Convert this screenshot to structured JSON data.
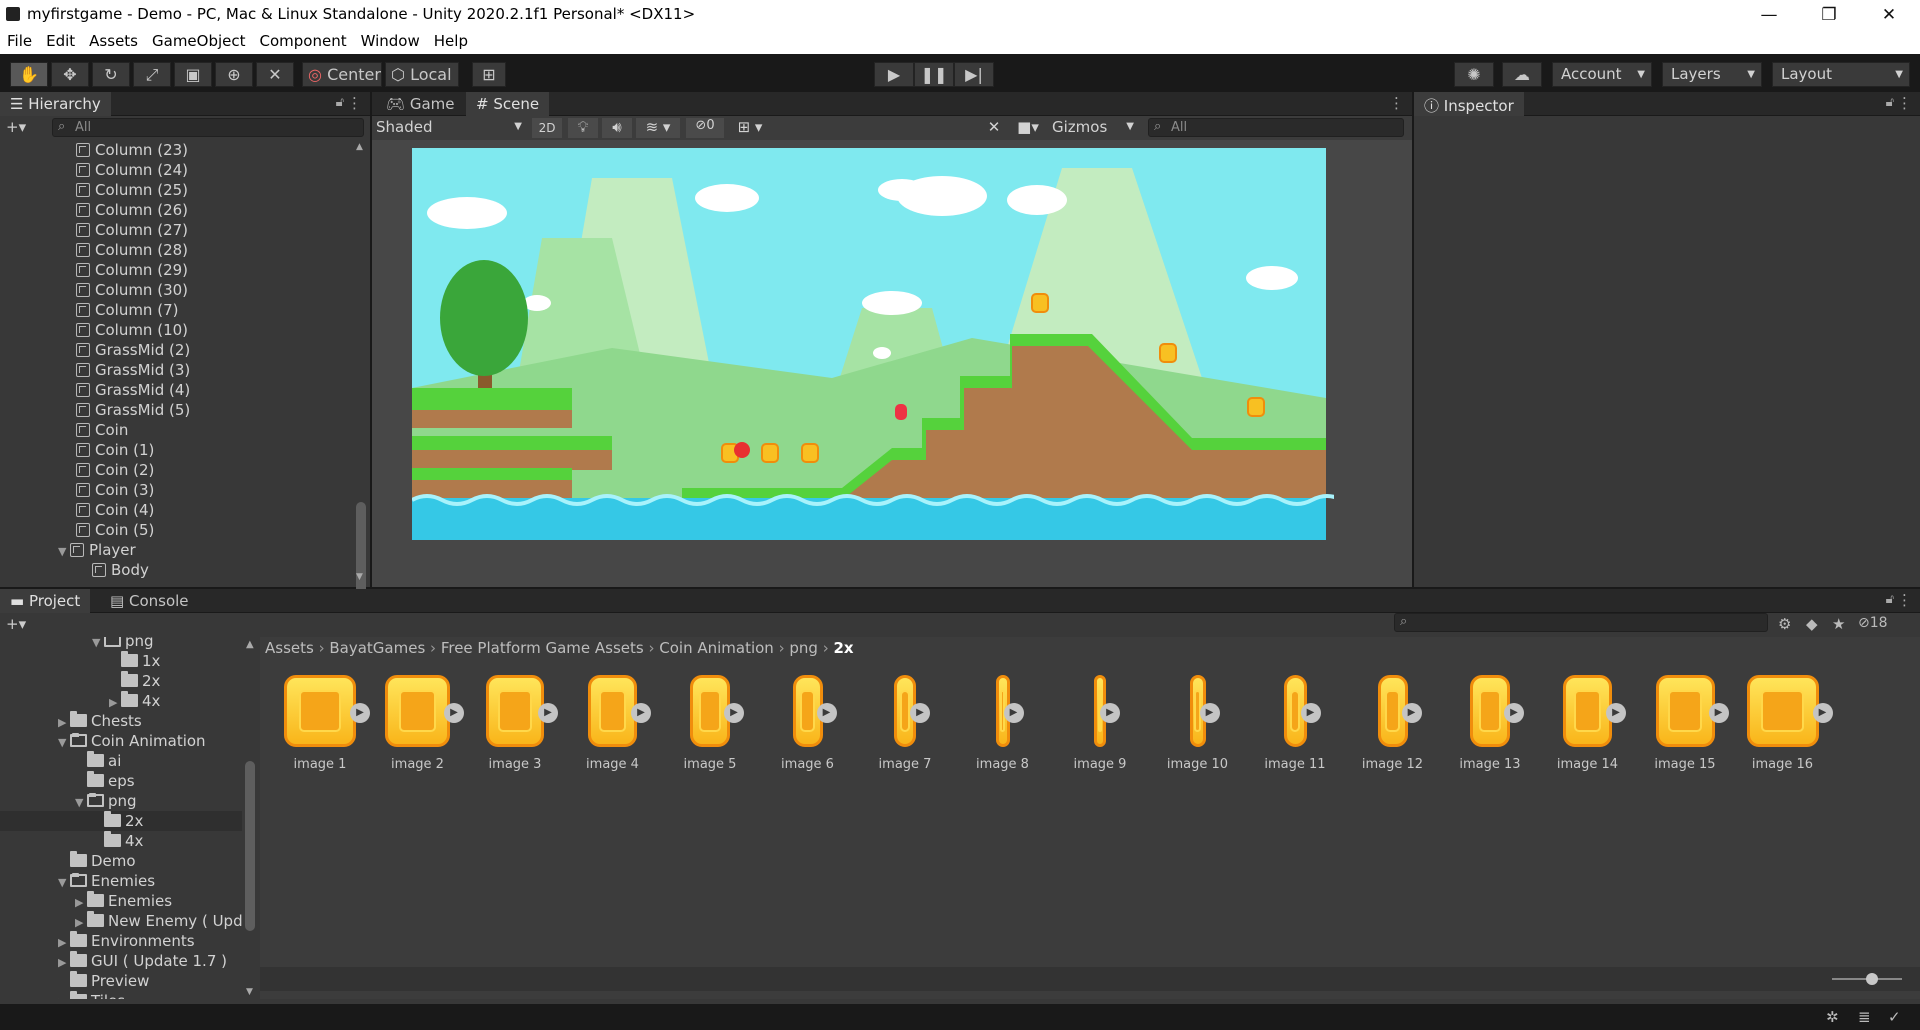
{
  "window": {
    "title": "myfirstgame - Demo - PC, Mac & Linux Standalone - Unity 2020.2.1f1 Personal* <DX11>",
    "minimize": "—",
    "maximize": "❐",
    "close": "✕"
  },
  "menu": [
    "File",
    "Edit",
    "Assets",
    "GameObject",
    "Component",
    "Window",
    "Help"
  ],
  "toolbar": {
    "pivot": "Center",
    "space": "Local",
    "account": "Account",
    "layers": "Layers",
    "layout": "Layout"
  },
  "hierarchy": {
    "tab": "Hierarchy",
    "add": "+▾",
    "search_placeholder": "All",
    "items": [
      {
        "label": "Column (23)",
        "type": "object",
        "depth": 1
      },
      {
        "label": "Column (24)",
        "type": "object",
        "depth": 1
      },
      {
        "label": "Column (25)",
        "type": "object",
        "depth": 1
      },
      {
        "label": "Column (26)",
        "type": "object",
        "depth": 1
      },
      {
        "label": "Column (27)",
        "type": "object",
        "depth": 1
      },
      {
        "label": "Column (28)",
        "type": "object",
        "depth": 1
      },
      {
        "label": "Column (29)",
        "type": "object",
        "depth": 1
      },
      {
        "label": "Column (30)",
        "type": "object",
        "depth": 1
      },
      {
        "label": "Column (7)",
        "type": "object",
        "depth": 1
      },
      {
        "label": "Column (10)",
        "type": "object",
        "depth": 1
      },
      {
        "label": "GrassMid (2)",
        "type": "object",
        "depth": 1
      },
      {
        "label": "GrassMid (3)",
        "type": "object",
        "depth": 1
      },
      {
        "label": "GrassMid (4)",
        "type": "object",
        "depth": 1
      },
      {
        "label": "GrassMid (5)",
        "type": "object",
        "depth": 1
      },
      {
        "label": "Coin",
        "type": "object",
        "depth": 1
      },
      {
        "label": "Coin (1)",
        "type": "object",
        "depth": 1
      },
      {
        "label": "Coin (2)",
        "type": "object",
        "depth": 1
      },
      {
        "label": "Coin (3)",
        "type": "object",
        "depth": 1
      },
      {
        "label": "Coin (4)",
        "type": "object",
        "depth": 1
      },
      {
        "label": "Coin (5)",
        "type": "object",
        "depth": 1
      },
      {
        "label": "Player",
        "type": "object",
        "depth": 0,
        "expanded": true
      },
      {
        "label": "Body",
        "type": "object",
        "depth": 2
      }
    ]
  },
  "scene": {
    "tabs": [
      "Game",
      "Scene"
    ],
    "shading": "Shaded",
    "mode2d": "2D",
    "hidden_count": "0",
    "gizmos": "Gizmos",
    "search_placeholder": "All",
    "colors": {
      "sky": "#7fe9ef",
      "water": "#35c8e6",
      "grass": "#55d23c",
      "dirt": "#b07a4c"
    }
  },
  "inspector": {
    "tab": "Inspector"
  },
  "project": {
    "tabs": [
      "Project",
      "Console"
    ],
    "add": "+▾",
    "badge": "18",
    "tree": [
      {
        "label": "png",
        "depth": 2,
        "open": true,
        "arrow": "▼"
      },
      {
        "label": "1x",
        "depth": 3
      },
      {
        "label": "2x",
        "depth": 3
      },
      {
        "label": "4x",
        "depth": 3,
        "arrow": "▶"
      },
      {
        "label": "Chests",
        "depth": 0,
        "arrow": "▶"
      },
      {
        "label": "Coin Animation",
        "depth": 0,
        "open": true,
        "arrow": "▼"
      },
      {
        "label": "ai",
        "depth": 1
      },
      {
        "label": "eps",
        "depth": 1
      },
      {
        "label": "png",
        "depth": 1,
        "open": true,
        "arrow": "▼"
      },
      {
        "label": "2x",
        "depth": 2,
        "selected": true
      },
      {
        "label": "4x",
        "depth": 2
      },
      {
        "label": "Demo",
        "depth": 0
      },
      {
        "label": "Enemies",
        "depth": 0,
        "open": true,
        "arrow": "▼"
      },
      {
        "label": "Enemies",
        "depth": 1,
        "arrow": "▶"
      },
      {
        "label": "New Enemy ( Upd",
        "depth": 1,
        "arrow": "▶"
      },
      {
        "label": "Environments",
        "depth": 0,
        "arrow": "▶"
      },
      {
        "label": "GUI ( Update 1.7 )",
        "depth": 0,
        "arrow": "▶"
      },
      {
        "label": "Preview",
        "depth": 0
      },
      {
        "label": "Tiles",
        "depth": 0,
        "arrow": "▶"
      }
    ],
    "breadcrumb": [
      "Assets",
      "BayatGames",
      "Free Platform Game Assets",
      "Coin Animation",
      "png",
      "2x"
    ],
    "assets": [
      {
        "label": "image 1",
        "w": 1.0
      },
      {
        "label": "image 2",
        "w": 0.9
      },
      {
        "label": "image 3",
        "w": 0.8
      },
      {
        "label": "image 4",
        "w": 0.68
      },
      {
        "label": "image 5",
        "w": 0.55
      },
      {
        "label": "image 6",
        "w": 0.42
      },
      {
        "label": "image 7",
        "w": 0.3
      },
      {
        "label": "image 8",
        "w": 0.2
      },
      {
        "label": "image 9",
        "w": 0.16
      },
      {
        "label": "image 10",
        "w": 0.22
      },
      {
        "label": "image 11",
        "w": 0.32
      },
      {
        "label": "image 12",
        "w": 0.42
      },
      {
        "label": "image 13",
        "w": 0.55
      },
      {
        "label": "image 14",
        "w": 0.68
      },
      {
        "label": "image 15",
        "w": 0.82
      },
      {
        "label": "image 16",
        "w": 1.0
      }
    ]
  }
}
